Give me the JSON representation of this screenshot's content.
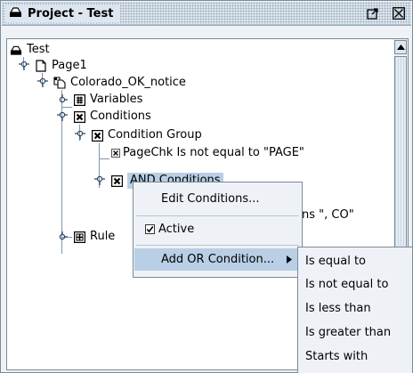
{
  "panel": {
    "title": "Project - Test"
  },
  "tree": {
    "nodes": [
      {
        "label": "Test"
      },
      {
        "label": "Page1"
      },
      {
        "label": "Colorado_OK_notice"
      },
      {
        "label": "Variables"
      },
      {
        "label": "Conditions"
      },
      {
        "label": "Condition Group"
      },
      {
        "label": "PageChk Is not equal to \"PAGE\""
      },
      {
        "label": "AND Conditions"
      },
      {
        "label": "ns \", CO\""
      },
      {
        "label": "Rule"
      }
    ]
  },
  "context_menu": {
    "items": [
      {
        "label": "Edit Conditions..."
      },
      {
        "label": "Active",
        "checked": true
      },
      {
        "label": "Add OR Condition..."
      }
    ]
  },
  "submenu": {
    "items": [
      {
        "label": "Is equal to"
      },
      {
        "label": "Is not equal to"
      },
      {
        "label": "Is less than"
      },
      {
        "label": "Is greater than"
      },
      {
        "label": "Starts with"
      }
    ]
  }
}
